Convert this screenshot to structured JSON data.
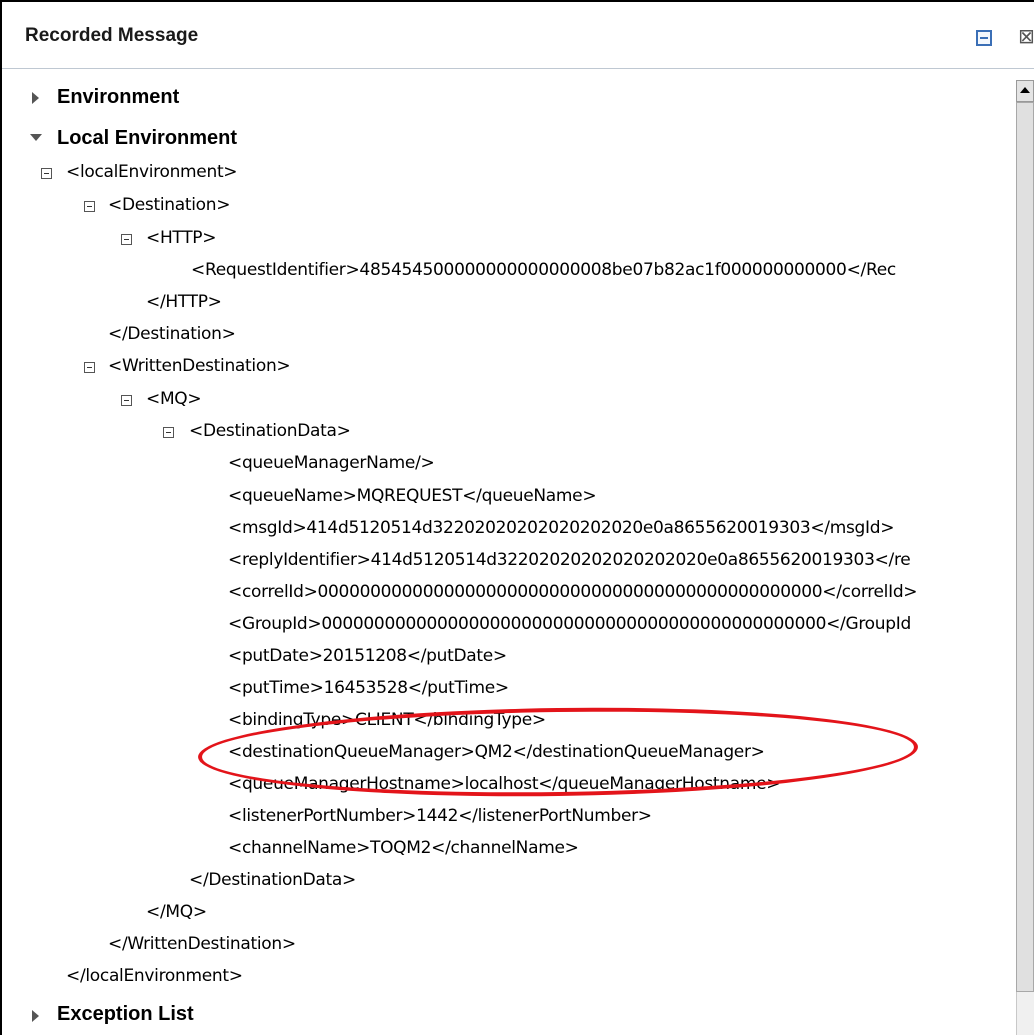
{
  "panel": {
    "title": "Recorded Message",
    "minimize_icon": "minimize-icon",
    "close_glyph": "⊠"
  },
  "sections": {
    "environment": "Environment",
    "local_environment": "Local Environment",
    "exception_list": "Exception List"
  },
  "tree": {
    "localEnvironment_open": "<localEnvironment>",
    "destination_open": "<Destination>",
    "http_open": "<HTTP>",
    "request_identifier": "<RequestIdentifier>485454500000000000000008be07b82ac1f000000000000</Rec",
    "http_close": "</HTTP>",
    "destination_close": "</Destination>",
    "written_destination_open": "<WrittenDestination>",
    "mq_open": "<MQ>",
    "destination_data_open": "<DestinationData>",
    "queue_manager_name": "<queueManagerName/>",
    "queue_name": "<queueName>MQREQUEST</queueName>",
    "msg_id": "<msgId>414d5120514d32202020202020202020e0a8655620019303</msgId>",
    "reply_identifier": "<replyIdentifier>414d5120514d32202020202020202020e0a8655620019303</re",
    "correl_id": "<correlId>000000000000000000000000000000000000000000000000</correlId>",
    "group_id": "<GroupId>000000000000000000000000000000000000000000000000</GroupId",
    "put_date": "<putDate>20151208</putDate>",
    "put_time": "<putTime>16453528</putTime>",
    "binding_type": "<bindingType>CLIENT</bindingType>",
    "destination_queue_manager": "<destinationQueueManager>QM2</destinationQueueManager>",
    "queue_manager_hostname": "<queueManagerHostname>localhost</queueManagerHostname>",
    "listener_port_number": "<listenerPortNumber>1442</listenerPortNumber>",
    "channel_name": "<channelName>TOQM2</channelName>",
    "destination_data_close": "</DestinationData>",
    "mq_close": "</MQ>",
    "written_destination_close": "</WrittenDestination>",
    "localEnvironment_close": "</localEnvironment>"
  },
  "colors": {
    "highlight_ellipse": "#e3141a",
    "accent": "#3b6fb6"
  }
}
